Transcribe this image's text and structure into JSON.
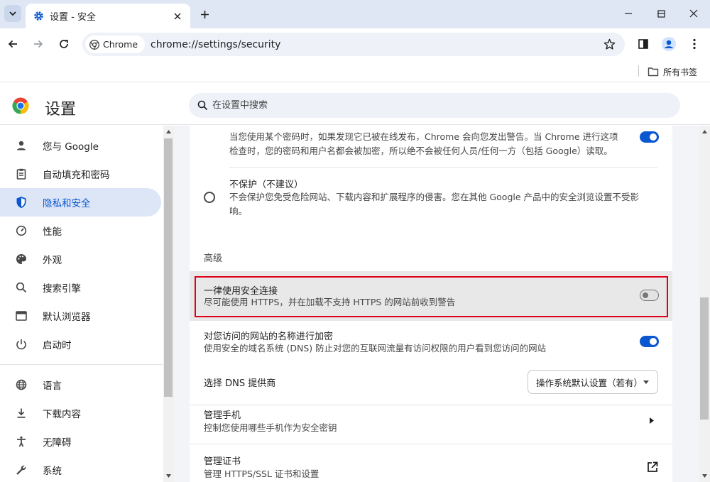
{
  "tab": {
    "title": "设置 - 安全"
  },
  "toolbar": {
    "chip_label": "Chrome",
    "url": "chrome://settings/security"
  },
  "bookmarks": {
    "all_bookmarks": "所有书签"
  },
  "header": {
    "title": "设置",
    "search_placeholder": "在设置中搜索"
  },
  "sidebar": {
    "items": [
      {
        "label": "您与 Google",
        "icon": "person-icon"
      },
      {
        "label": "自动填充和密码",
        "icon": "clipboard-icon"
      },
      {
        "label": "隐私和安全",
        "icon": "shield-icon",
        "active": true
      },
      {
        "label": "性能",
        "icon": "speedometer-icon"
      },
      {
        "label": "外观",
        "icon": "palette-icon"
      },
      {
        "label": "搜索引擎",
        "icon": "search-icon"
      },
      {
        "label": "默认浏览器",
        "icon": "browser-window-icon"
      },
      {
        "label": "启动时",
        "icon": "power-icon"
      },
      {
        "label": "语言",
        "icon": "globe-icon"
      },
      {
        "label": "下载内容",
        "icon": "download-icon"
      },
      {
        "label": "无障碍",
        "icon": "accessibility-icon"
      },
      {
        "label": "系统",
        "icon": "wrench-icon"
      }
    ]
  },
  "main": {
    "password_warning": {
      "desc_line1": "当您使用某个密码时，如果发现它已被在线发布，Chrome 会向您发出警告。当 Chrome 进行这项",
      "desc_line2": "检查时，您的密码和用户名都会被加密，所以绝不会被任何人员/任何一方（包括 Google）读取。",
      "enabled": true
    },
    "no_protection": {
      "title": "不保护（不建议）",
      "desc_line1": "不会保护您免受危险网站、下载内容和扩展程序的侵害。您在其他 Google 产品中的安全浏览设置不受影",
      "desc_line2": "响。"
    },
    "advanced_heading": "高级",
    "https_first": {
      "title": "一律使用安全连接",
      "desc": "尽可能使用 HTTPS，并在加载不支持 HTTPS 的网站前收到警告",
      "enabled": false
    },
    "secure_dns": {
      "title": "对您访问的网站的名称进行加密",
      "desc": "使用安全的域名系统 (DNS) 防止对您的互联网流量有访问权限的用户看到您访问的网站",
      "enabled": true
    },
    "dns_provider": {
      "label": "选择 DNS 提供商",
      "selected": "操作系统默认设置（若有）"
    },
    "manage_phones": {
      "title": "管理手机",
      "desc": "控制您使用哪些手机作为安全密钥"
    },
    "manage_certs": {
      "title": "管理证书",
      "desc": "管理 HTTPS/SSL 证书和设置"
    }
  },
  "colors": {
    "accent": "#0b57d0",
    "highlight_border": "#e0001b",
    "tabstrip": "#dfe7f5"
  }
}
